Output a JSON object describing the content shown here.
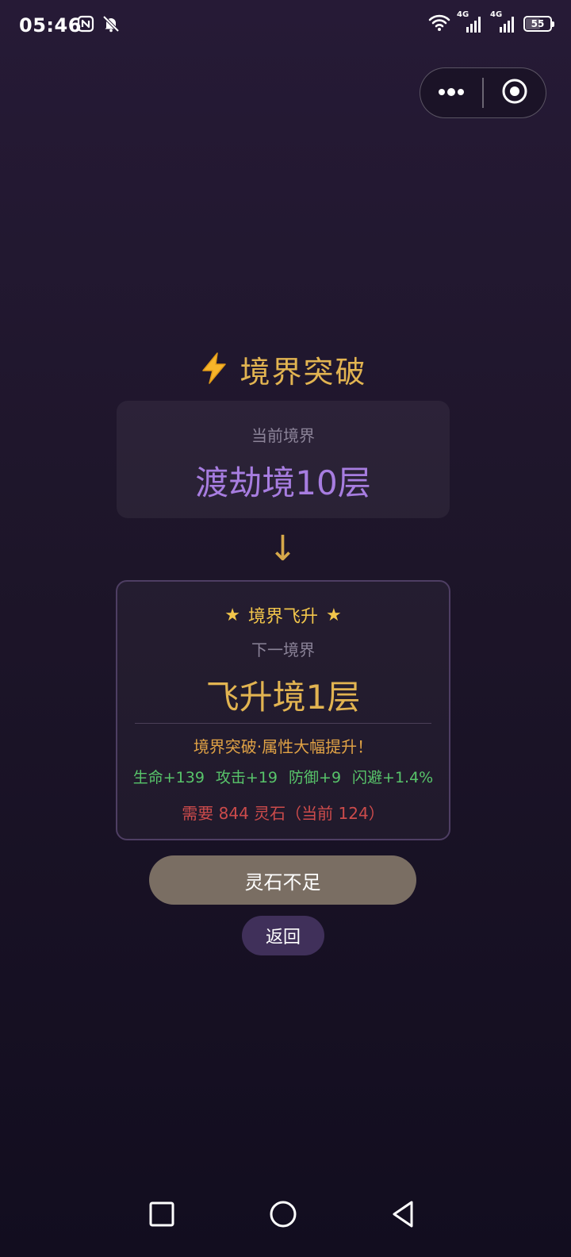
{
  "status_bar": {
    "time": "05:46",
    "battery": "55",
    "network_1": "4G",
    "network_2": "4G",
    "icons": [
      "nfc-icon",
      "bell-muted-icon",
      "wifi-icon",
      "signal-icon",
      "signal-icon",
      "battery-icon"
    ]
  },
  "capsule": {
    "more_icon": "more-dots-icon",
    "close_icon": "target-circle-icon"
  },
  "title": {
    "icon": "lightning-icon",
    "emoji": "⚡",
    "text": "境界突破"
  },
  "current_realm": {
    "label": "当前境界",
    "value": "渡劫境10层"
  },
  "arrow": "↓",
  "next_realm": {
    "star_left": "★",
    "ascend_title": "境界飞升",
    "star_right": "★",
    "label": "下一境界",
    "value": "飞升境1层",
    "boost_note": "境界突破·属性大幅提升！",
    "stats": [
      "生命+139",
      "攻击+19",
      "防御+9",
      "闪避+1.4%"
    ],
    "cost_text": "需要 844 灵石（当前 124）"
  },
  "buttons": {
    "insufficient_label": "灵石不足",
    "back_label": "返回"
  },
  "colors": {
    "accent_gold": "#e2b451",
    "realm_purple": "#a77de0",
    "stat_green": "#58c46a",
    "cost_red": "#cc4b4b",
    "disabled_button": "#7a6e63",
    "back_button": "#40305a"
  },
  "nav_bar": {
    "recent_icon": "square-recent-apps-icon",
    "home_icon": "circle-home-icon",
    "back_icon": "triangle-back-icon"
  }
}
